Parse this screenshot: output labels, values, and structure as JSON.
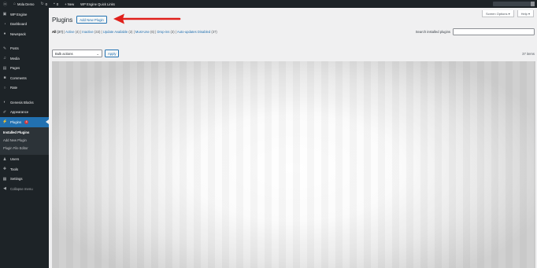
{
  "admin_bar": {
    "site_name": "Mola Demo",
    "updates": "0",
    "comments": "0",
    "new": "+ New",
    "quick_links": "WP Engine Quick Links"
  },
  "sidebar": {
    "top_items": [
      {
        "label": "WP Engine",
        "icon": "wp-engine-icon"
      },
      {
        "label": "Dashboard",
        "icon": "dashboard-icon"
      },
      {
        "label": "Newspack",
        "icon": "newspack-icon"
      }
    ],
    "mid_items": [
      {
        "label": "Posts",
        "icon": "pushpin-icon"
      },
      {
        "label": "Media",
        "icon": "media-icon"
      },
      {
        "label": "Pages",
        "icon": "pages-icon"
      },
      {
        "label": "Comments",
        "icon": "comment-icon"
      },
      {
        "label": "Rate",
        "icon": "rate-icon"
      }
    ],
    "lower_items": [
      {
        "label": "Genesis Blocks",
        "icon": "genesis-icon"
      },
      {
        "label": "Appearance",
        "icon": "brush-icon"
      }
    ],
    "plugins": {
      "label": "Plugins",
      "badge": "4",
      "icon": "plugin-icon"
    },
    "submenu": [
      "Installed Plugins",
      "Add New Plugin",
      "Plugin File Editor"
    ],
    "bottom_items": [
      {
        "label": "Users",
        "icon": "users-icon"
      },
      {
        "label": "Tools",
        "icon": "wrench-icon"
      },
      {
        "label": "Settings",
        "icon": "settings-icon"
      }
    ],
    "collapse_label": "Collapse menu"
  },
  "header": {
    "screen_options": "Screen Options ▾",
    "help": "Help ▾",
    "title": "Plugins",
    "add_new": "Add New Plugin"
  },
  "filters": [
    {
      "label": "All",
      "count": "(37)",
      "sep": " | "
    },
    {
      "label": "Active",
      "count": "(4)",
      "sep": " | "
    },
    {
      "label": "Inactive",
      "count": "(33)",
      "sep": " | "
    },
    {
      "label": "Update Available",
      "count": "(2)",
      "sep": " | "
    },
    {
      "label": "Must-Use",
      "count": "(6)",
      "sep": " | "
    },
    {
      "label": "Drop-ins",
      "count": "(3)",
      "sep": " | "
    },
    {
      "label": "Auto-updates Disabled",
      "count": "(37)",
      "sep": ""
    }
  ],
  "search": {
    "label": "Search installed plugins",
    "value": ""
  },
  "bulk": {
    "selected": "Bulk actions",
    "apply": "Apply"
  },
  "items_count": "37 items",
  "colors": {
    "accent": "#2271b1",
    "annotation": "#e0201b",
    "sidebar_bg": "#1d2327"
  }
}
